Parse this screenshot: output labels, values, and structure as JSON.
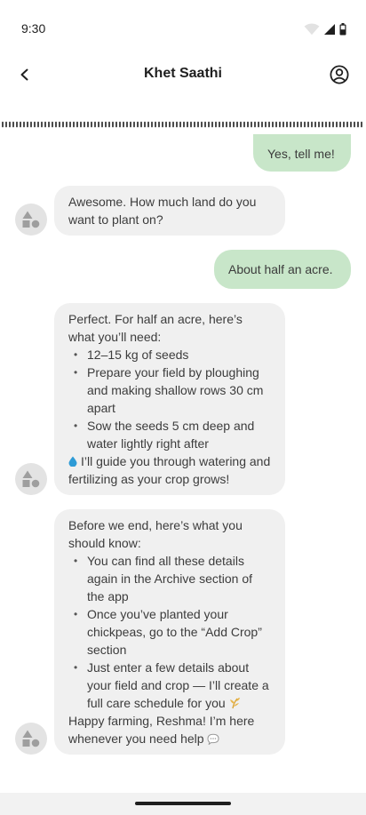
{
  "status_bar": {
    "time": "9:30"
  },
  "app_bar": {
    "title": "Khet Saathi",
    "back_icon": "chevron-left-icon",
    "profile_icon": "account-circle-icon"
  },
  "colors": {
    "user_bubble": "#c8e6c9",
    "bot_bubble": "#f0f0f0",
    "background": "#ffffff"
  },
  "messages": [
    {
      "sender": "user",
      "text": "Yes, tell me!"
    },
    {
      "sender": "bot",
      "text": "Awesome. How much land do you want to plant on?"
    },
    {
      "sender": "user",
      "text": "About half an acre."
    },
    {
      "sender": "bot",
      "intro": "Perfect. For half an acre, here’s what you’ll need:",
      "bullets": [
        "12–15 kg of seeds",
        "Prepare your field by ploughing and making shallow rows 30 cm apart",
        "Sow the seeds 5 cm deep and water lightly right after"
      ],
      "outro": "I’ll guide you through watering and fertilizing as your crop grows!",
      "outro_icon": "water-drop-icon"
    },
    {
      "sender": "bot",
      "intro": "Before we end, here’s what you should know:",
      "bullets": [
        "You can find all these details again in the Archive section of the app",
        "Once you’ve planted your chickpeas, go to the “Add Crop” section",
        "Just enter a few details about your field and crop — I’ll create a full care schedule for you"
      ],
      "bullet_3_icon": "sprout-icon",
      "outro": "Happy farming, Reshma! I’m here whenever you need help",
      "outro_icon": "speech-bubble-icon"
    }
  ]
}
